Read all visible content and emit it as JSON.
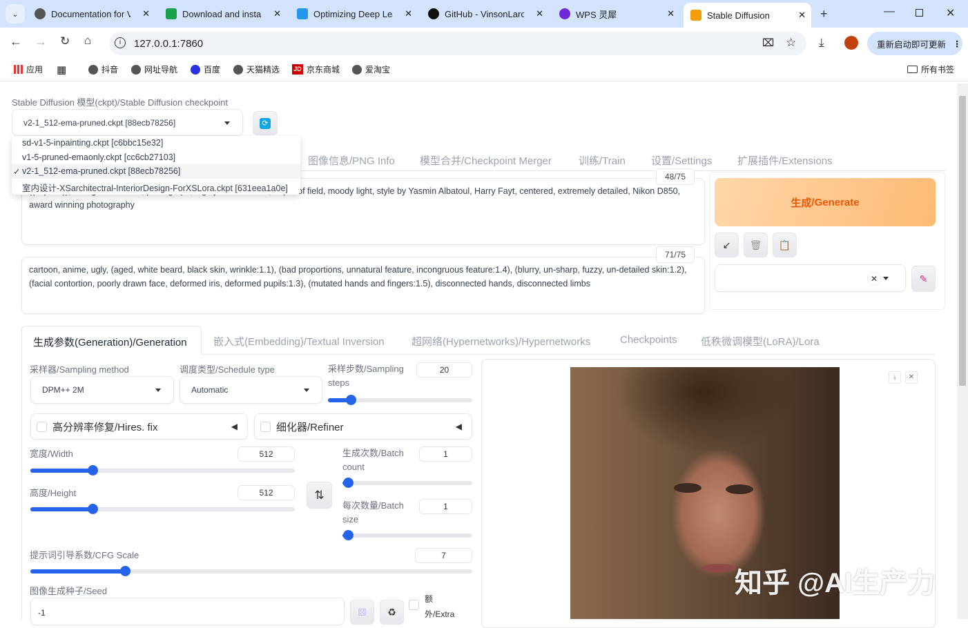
{
  "browser": {
    "tabs": [
      {
        "title": "Documentation for V",
        "color": "#555"
      },
      {
        "title": "Download and instal",
        "color": "#16a34a"
      },
      {
        "title": "Optimizing Deep Lea",
        "color": "#2496ed"
      },
      {
        "title": "GitHub - VinsonLaro",
        "color": "#111"
      },
      {
        "title": "WPS 灵犀",
        "color": "#6d28d9"
      },
      {
        "title": "Stable Diffusion",
        "color": "#f59e0b"
      }
    ],
    "url": "127.0.0.1:7860",
    "update_button": "重新启动即可更新",
    "bookmarks": [
      "应用",
      "抖音",
      "网址导航",
      "百度",
      "天猫精选",
      "京东商城",
      "爱淘宝"
    ],
    "all_bookmarks": "所有书签"
  },
  "checkpoint": {
    "label": "Stable Diffusion 模型(ckpt)/Stable Diffusion checkpoint",
    "selected": "v2-1_512-ema-pruned.ckpt [88ecb78256]",
    "options": [
      "sd-v1-5-inpainting.ckpt [c6bbc15e32]",
      "v1-5-pruned-emaonly.ckpt [cc6cb27103]",
      "v2-1_512-ema-pruned.ckpt [88ecb78256]",
      "室内设计-XSarchitectral-InteriorDesign-ForXSLora.ckpt [631eea1a0e]"
    ],
    "check": "✓"
  },
  "main_tabs": [
    "图像信息/PNG Info",
    "模型合并/Checkpoint Merger",
    "训练/Train",
    "设置/Settings",
    "扩展插件/Extensions"
  ],
  "prompt": {
    "text": "((caption)), facing the camera, photograph, highly detailed face, depth of field, moody light, style by Yasmin Albatoul, Harry Fayt, centered, extremely detailed, Nikon D850, award winning photography",
    "counter": "48/75"
  },
  "negative_prompt": {
    "text": "cartoon, anime, ugly, (aged, white beard, black skin, wrinkle:1.1), (bad proportions, unnatural feature, incongruous feature:1.4), (blurry, un-sharp, fuzzy, un-detailed skin:1.2), (facial contortion, poorly drawn face, deformed iris, deformed pupils:1.3), (mutated hands and fingers:1.5), disconnected hands, disconnected limbs",
    "counter": "71/75"
  },
  "generate": {
    "label_cn": "生成",
    "label_en": "/Generate"
  },
  "sub_tabs": [
    "生成参数(Generation)/Generation",
    "嵌入式(Embedding)/Textual Inversion",
    "超网络(Hypernetworks)/Hypernetworks",
    "Checkpoints",
    "低秩微调模型(LoRA)/Lora"
  ],
  "params": {
    "sampler": {
      "label": "采样器/Sampling method",
      "value": "DPM++ 2M"
    },
    "schedule": {
      "label": "调度类型/Schedule type",
      "value": "Automatic"
    },
    "steps": {
      "label": "采样步数/Sampling steps",
      "value": "20",
      "fraction": 0.16
    },
    "hires": "高分辨率修复/Hires. fix",
    "refiner": "细化器/Refiner",
    "width": {
      "label": "宽度/Width",
      "value": "512",
      "fraction": 0.235
    },
    "height": {
      "label": "高度/Height",
      "value": "512",
      "fraction": 0.235
    },
    "batch_count": {
      "label": "生成次数/Batch count",
      "value": "1",
      "fraction": 0.04
    },
    "batch_size": {
      "label": "每次数量/Batch size",
      "value": "1",
      "fraction": 0.04
    },
    "cfg": {
      "label": "提示词引导系数/CFG Scale",
      "value": "7",
      "fraction": 0.214
    },
    "seed": {
      "label": "图像生成种子/Seed",
      "value": "-1"
    },
    "extra": "额外/Extra"
  },
  "output": {
    "watermark": "知乎 @AI生产力"
  }
}
